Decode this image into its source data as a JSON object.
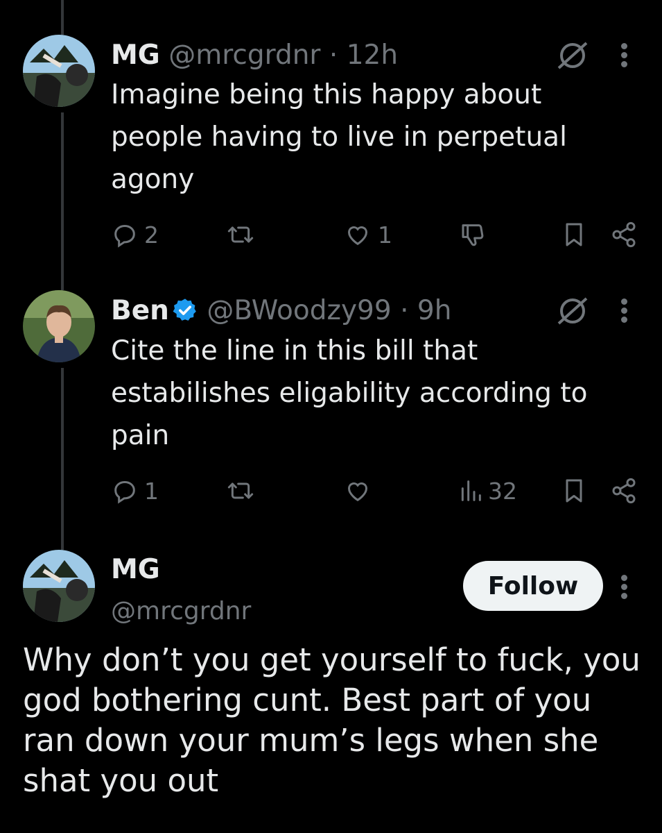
{
  "colors": {
    "background": "#000000",
    "text_primary": "#e7e9ea",
    "text_secondary": "#71767b",
    "verified_blue": "#1d9bf0",
    "follow_button_bg": "#eff3f4",
    "thread_line": "#333639"
  },
  "replies": [
    {
      "name": "MG",
      "handle": "@mrcgrdnr",
      "separator": "·",
      "time": "12h",
      "verified": false,
      "avatar_icon": "landscape-photo-avatar",
      "text": "Imagine being this happy about people having to live in perpetual agony",
      "actions": {
        "reply_count": "2",
        "repost_count": "",
        "like_count": "1",
        "third_action_icon": "dislike-icon",
        "third_action_count": ""
      }
    },
    {
      "name": "Ben",
      "handle": "@BWoodzy99",
      "separator": "·",
      "time": "9h",
      "verified": true,
      "avatar_icon": "profile-photo-avatar",
      "text": "Cite the line in this bill that estabilishes eligability according to pain",
      "actions": {
        "reply_count": "1",
        "repost_count": "",
        "like_count": "",
        "third_action_icon": "views-icon",
        "third_action_count": "32"
      }
    }
  ],
  "main_post": {
    "name": "MG",
    "handle": "@mrcgrdnr",
    "follow_label": "Follow",
    "avatar_icon": "landscape-photo-avatar",
    "text": "Why don’t you get yourself to fuck, you god bothering cunt. Best part of you ran down your mum’s legs when she shat you out"
  }
}
